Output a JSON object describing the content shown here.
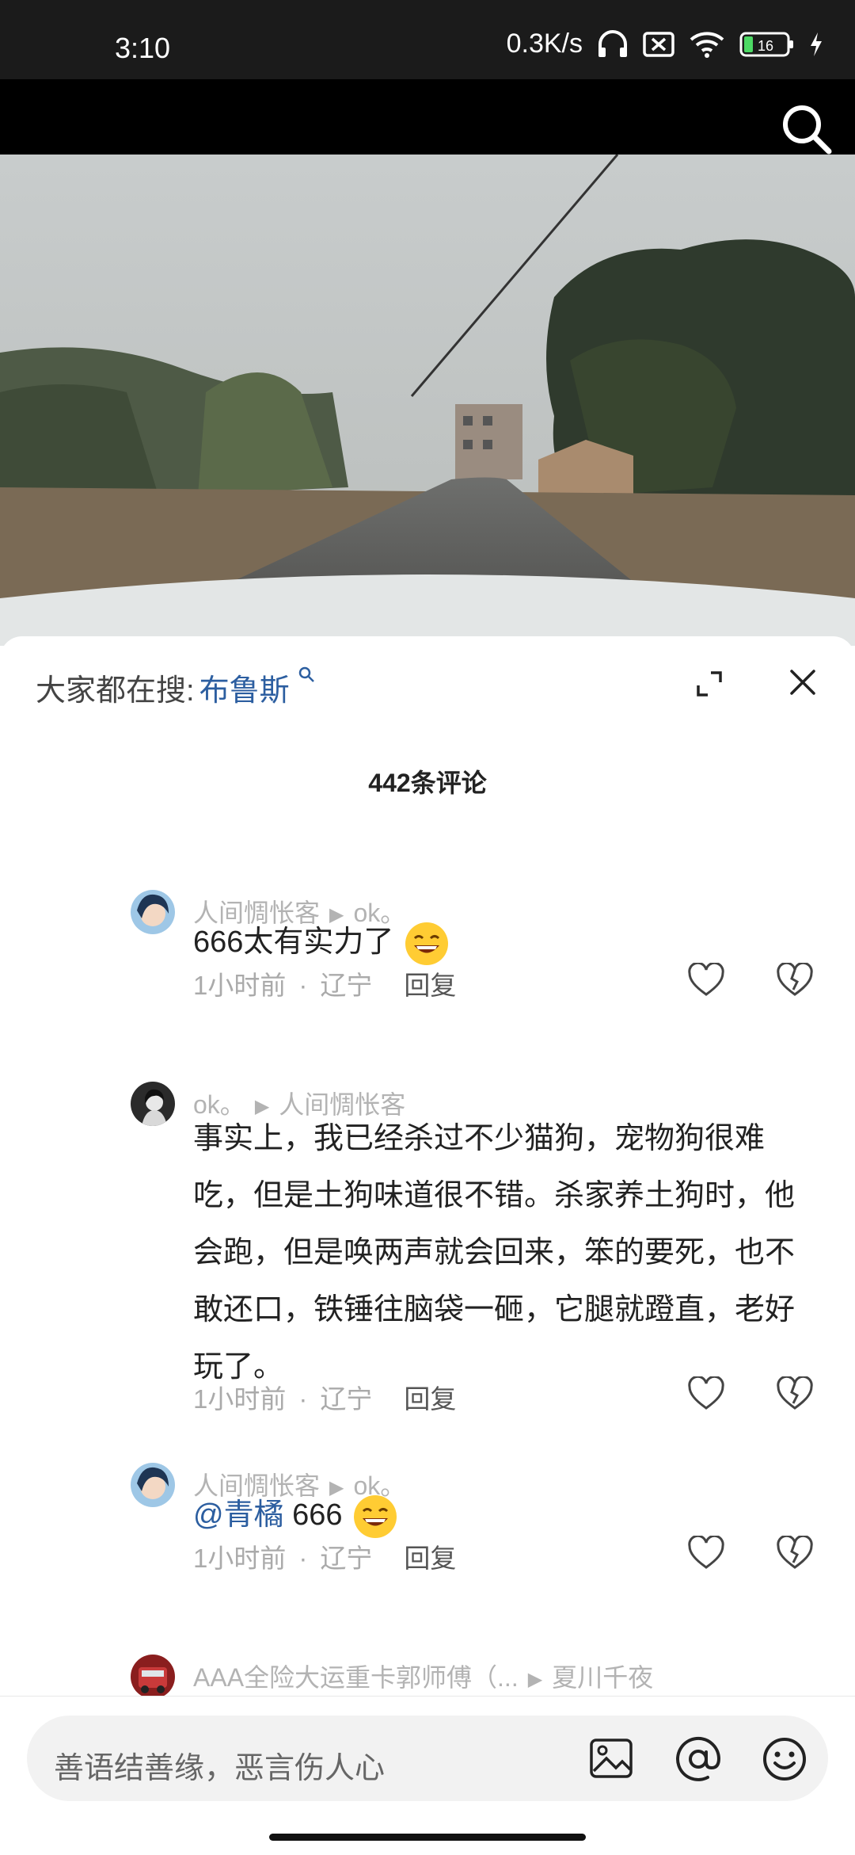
{
  "status_bar": {
    "time": "3:10",
    "speed": "0.3K/s",
    "battery": "16"
  },
  "trending": {
    "prefix": "大家都在搜:",
    "keyword": "布鲁斯"
  },
  "comments_header": {
    "count_label": "442条评论"
  },
  "comments": [
    {
      "author": "人间惆怅客",
      "reply_to": "ok。",
      "text": "666太有实力了",
      "time": "1小时前",
      "location": "辽宁",
      "reply_label": "回复"
    },
    {
      "author": "ok。",
      "reply_to": "人间惆怅客",
      "text_lines": [
        "事实上，我已经杀过不少猫狗，宠物狗很难",
        "吃，但是土狗味道很不错。杀家养土狗时，他",
        "会跑，但是唤两声就会回来，笨的要死，也不",
        "敢还口，铁锤往脑袋一砸，它腿就蹬直，老好",
        "玩了。"
      ],
      "time": "1小时前",
      "location": "辽宁",
      "reply_label": "回复"
    },
    {
      "author": "人间惆怅客",
      "reply_to": "ok。",
      "mention": "@青橘",
      "text": " 666",
      "time": "1小时前",
      "location": "辽宁",
      "reply_label": "回复"
    },
    {
      "author": "AAA全险大运重卡郭师傅（...",
      "reply_to": "夏川千夜"
    }
  ],
  "input": {
    "placeholder": "善语结善缘，恶言伤人心"
  },
  "colors": {
    "accent_link": "#2c5ea0",
    "muted_text": "#b3b3b3"
  }
}
